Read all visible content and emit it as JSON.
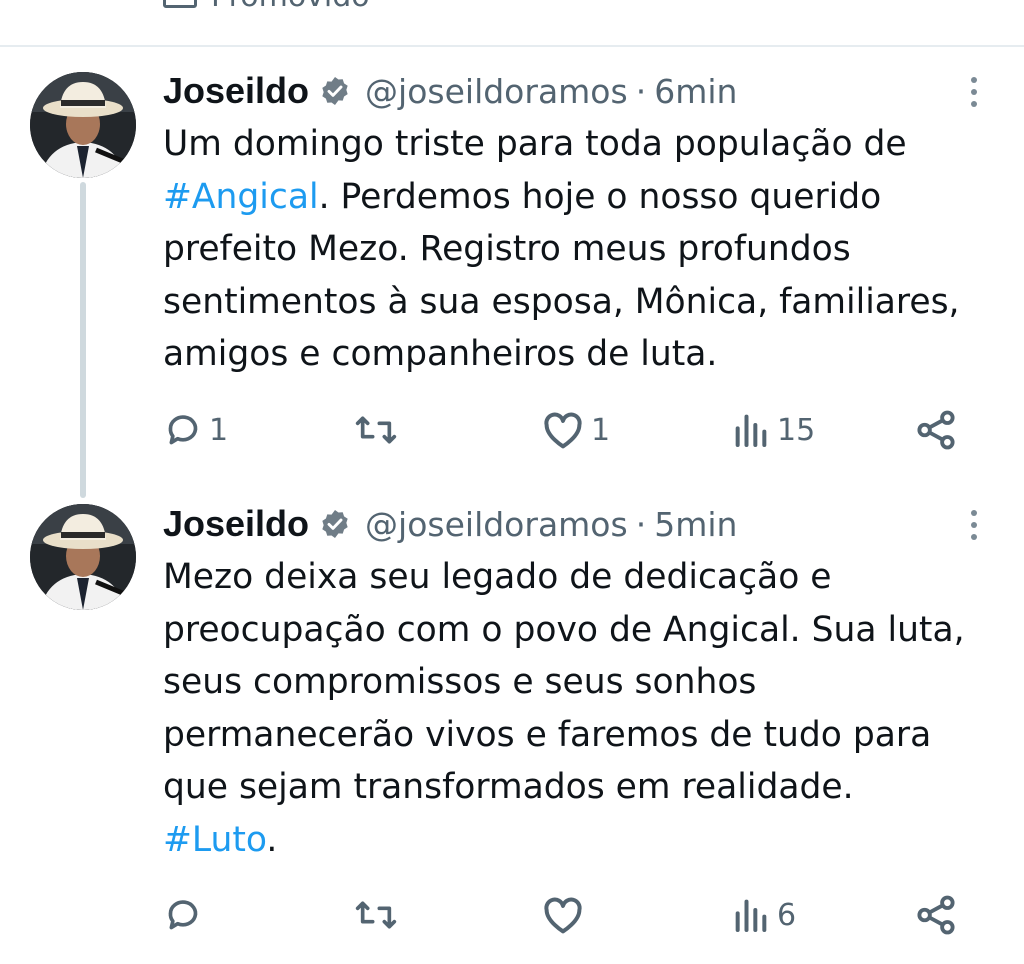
{
  "top": {
    "promoted_label": "Promovido"
  },
  "tweets": [
    {
      "author_name": "Joseildo",
      "handle": "@joseildoramos",
      "separator": "·",
      "time": "6min",
      "lines": [
        [
          "Um domingo triste para toda população de"
        ],
        [
          "#Angical",
          ". Perdemos hoje o nosso querido"
        ],
        [
          "prefeito Mezo. Registro meus profundos"
        ],
        [
          "sentimentos à sua esposa, Mônica, familiares,"
        ],
        [
          "amigos e companheiros de luta."
        ]
      ],
      "actions": {
        "replies": "1",
        "reposts": "",
        "likes": "1",
        "views": "15"
      }
    },
    {
      "author_name": "Joseildo",
      "handle": "@joseildoramos",
      "separator": "·",
      "time": "5min",
      "lines": [
        [
          "Mezo deixa seu legado de dedicação e"
        ],
        [
          "preocupação com o povo de Angical. Sua luta,"
        ],
        [
          "seus compromissos e seus sonhos"
        ],
        [
          "permanecerão vivos e faremos de tudo para"
        ],
        [
          "que sejam transformados em realidade."
        ],
        [
          "#Luto",
          "."
        ]
      ],
      "actions": {
        "replies": "",
        "reposts": "",
        "likes": "",
        "views": "6"
      }
    }
  ],
  "icons": {
    "verified": "verified-badge-icon",
    "reply": "reply-icon",
    "repost": "repost-icon",
    "like": "like-icon",
    "views": "views-icon",
    "share": "share-icon",
    "more": "more-options-icon"
  },
  "colors": {
    "link": "#1d9bf0",
    "secondary": "#536471",
    "text": "#0f1419"
  }
}
